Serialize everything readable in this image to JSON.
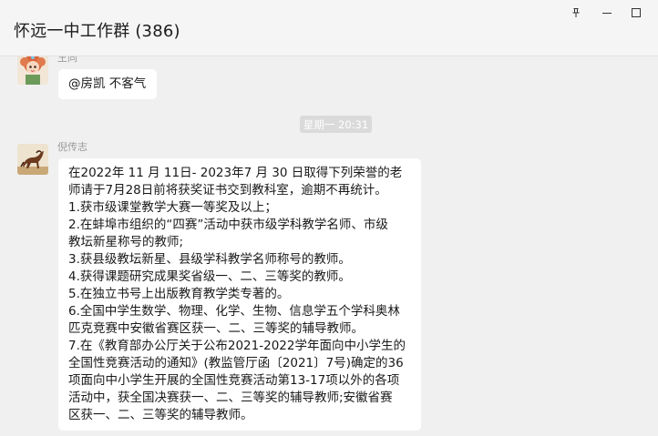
{
  "window": {
    "title": "怀远一中工作群 (386)",
    "controls": [
      "pin-icon",
      "minimize-icon",
      "maximize-icon"
    ]
  },
  "messages": [
    {
      "sender": "王同",
      "avatar": "cartoon-girl-avatar",
      "text": "@房凯 不客气"
    },
    {
      "sender": "倪传志",
      "avatar": "horse-avatar",
      "text": "在2022年 11 月 11日- 2023年7 月 30 日取得下列荣誉的老\n师请于7月28日前将获奖证书交到教科室，逾期不再统计。\n1.获市级课堂教学大赛一等奖及以上；\n2.在蚌埠市组织的“四赛”活动中获市级学科教学名师、市级\n教坛新星称号的教师;\n3.获县级教坛新星、县级学科教学名师称号的教师。\n4.获得课题研究成果奖省级一、二、三等奖的教师。\n5.在独立书号上出版教育教学类专著的。\n6.全国中学生数学、物理、化学、生物、信息学五个学科奥林\n匹克竞赛中安徽省赛区获一、二、三等奖的辅导教师。\n7.在《教育部办公厅关于公布2021-2022学年面向中小学生的\n全国性竞赛活动的通知》(教监管厅函〔2021〕7号)确定的36\n项面向中小学生开展的全国性竞赛活动第13-17项以外的各项\n活动中，获全国决赛获一、二、三等奖的辅导教师;安徽省赛\n区获一、二、三等奖的辅导教师。"
    }
  ],
  "timestamp": "星期一 20:31",
  "colors": {
    "background": "#f0f0f0",
    "bubble": "#ffffff",
    "timestamp_bg": "#dadada",
    "accent_line": "#5f9ad8"
  }
}
